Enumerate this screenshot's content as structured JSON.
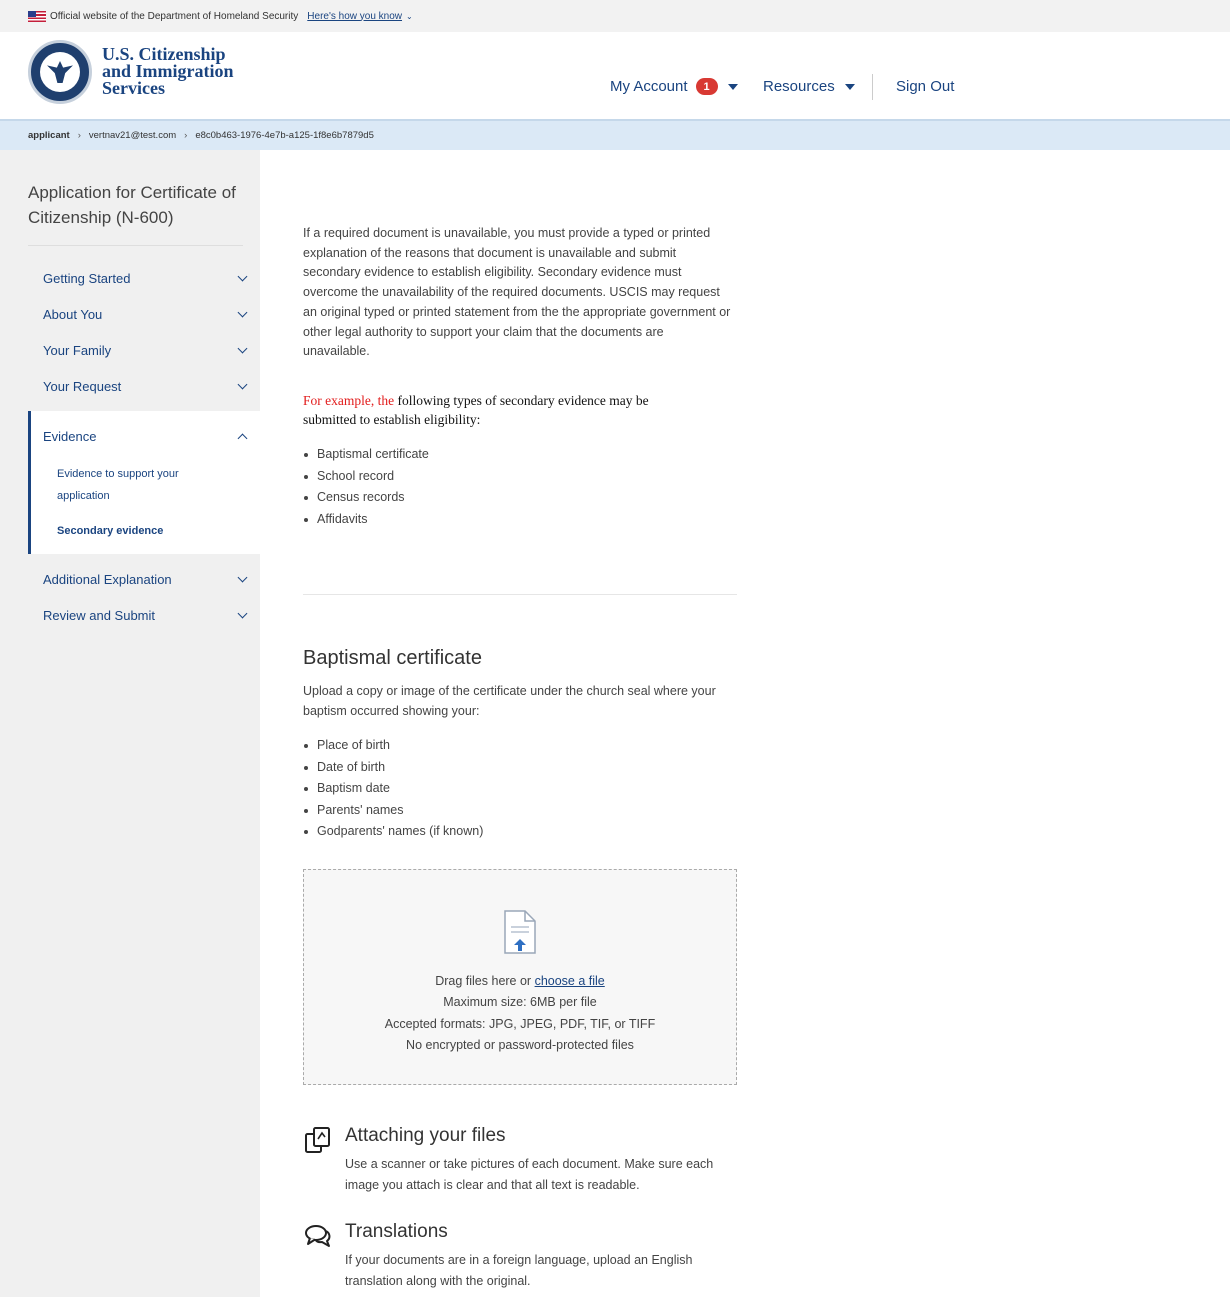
{
  "gov_banner": {
    "text": "Official website of the Department of Homeland Security",
    "link": "Here's how you know"
  },
  "header": {
    "agency_line1": "U.S. Citizenship",
    "agency_line2": "and Immigration",
    "agency_line3": "Services",
    "my_account": "My Account",
    "account_badge": "1",
    "resources": "Resources",
    "sign_out": "Sign Out"
  },
  "breadcrumb": {
    "items": [
      "applicant",
      "vertnav21@test.com",
      "e8c0b463-1976-4e7b-a125-1f8e6b7879d5"
    ]
  },
  "sidebar": {
    "title": "Application for Certificate of Citizenship (N-600)",
    "items": [
      {
        "label": "Getting Started"
      },
      {
        "label": "About You"
      },
      {
        "label": "Your Family"
      },
      {
        "label": "Your Request"
      },
      {
        "label": "Evidence"
      },
      {
        "label": "Additional Explanation"
      },
      {
        "label": "Review and Submit"
      }
    ],
    "subitems": [
      {
        "label": "Evidence to support your application"
      },
      {
        "label": "Secondary evidence"
      }
    ]
  },
  "main": {
    "intro": "If a required document is unavailable, you must provide a typed or printed explanation of the reasons that document is unavailable and submit secondary evidence to establish eligibility. Secondary evidence must overcome the unavailability of the required documents. USCIS may request an original typed or printed statement from the the appropriate government or other legal authority to support your claim that the documents are unavailable.",
    "example_red": "For example, the",
    "example_rest": " following types of secondary evidence may be submitted to establish eligibility:",
    "evidence_types": [
      "Baptismal certificate",
      "School record",
      "Census records",
      "Affidavits"
    ],
    "section_title": "Baptismal certificate",
    "section_text": "Upload a copy or image of the certificate under the church seal where your baptism occurred showing your:",
    "certificate_fields": [
      "Place of birth",
      "Date of birth",
      "Baptism date",
      "Parents' names",
      "Godparents' names (if known)"
    ],
    "dropzone": {
      "drag_text": "Drag files here or ",
      "choose_link": "choose a file",
      "max_size": "Maximum size: 6MB per file",
      "formats": "Accepted formats: JPG, JPEG, PDF, TIF, or TIFF",
      "no_encrypted": "No encrypted or password-protected files"
    },
    "attaching": {
      "title": "Attaching your files",
      "text": "Use a scanner or take pictures of each document. Make sure each image you attach is clear and that all text is readable."
    },
    "translations": {
      "title": "Translations",
      "text": "If your documents are in a foreign language, upload an English translation along with the original."
    }
  },
  "colors": {
    "link_blue": "#1a4480",
    "sidebar_bg": "#f0f0f0",
    "breadcrumb_bg": "#dbe9f6",
    "badge_red": "#d83933",
    "example_red": "#e21c1c"
  }
}
